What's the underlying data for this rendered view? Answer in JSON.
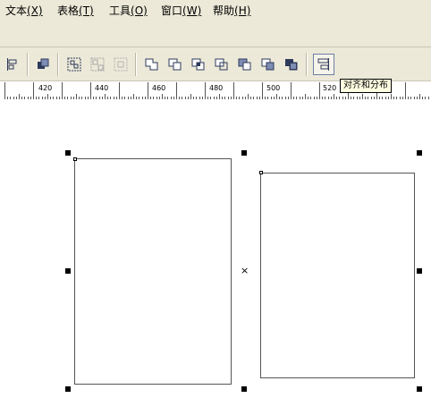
{
  "menu": {
    "items": [
      {
        "label": "文本",
        "accel": "(X)"
      },
      {
        "label": "表格",
        "accel": "(T)"
      },
      {
        "label": "工具",
        "accel": "(O)"
      },
      {
        "label": "窗口",
        "accel": "(W)"
      },
      {
        "label": "帮助",
        "accel": "(H)"
      }
    ]
  },
  "toolbar": {
    "buttons": [
      {
        "name": "align-left-icon",
        "enabled": true
      },
      {
        "name": "bring-to-front-icon",
        "enabled": true
      },
      {
        "name": "group-icon",
        "enabled": true
      },
      {
        "name": "ungroup-icon",
        "enabled": false
      },
      {
        "name": "ungroup-all-icon",
        "enabled": false
      },
      {
        "name": "weld-icon",
        "enabled": true
      },
      {
        "name": "trim-icon",
        "enabled": true
      },
      {
        "name": "intersect-icon",
        "enabled": true
      },
      {
        "name": "simplify-icon",
        "enabled": true
      },
      {
        "name": "front-minus-back-icon",
        "enabled": true
      },
      {
        "name": "back-minus-front-icon",
        "enabled": true
      },
      {
        "name": "boundary-icon",
        "enabled": true
      },
      {
        "name": "align-distribute-icon",
        "enabled": true,
        "active": true
      }
    ],
    "tooltip": "对齐和分布"
  },
  "ruler": {
    "labels": [
      "420",
      "440",
      "460",
      "480",
      "500",
      "520"
    ]
  },
  "colors": {
    "chrome": "#ece9d8",
    "tooltip_bg": "#ffffe1",
    "icon_dark": "#2e3a5c"
  }
}
